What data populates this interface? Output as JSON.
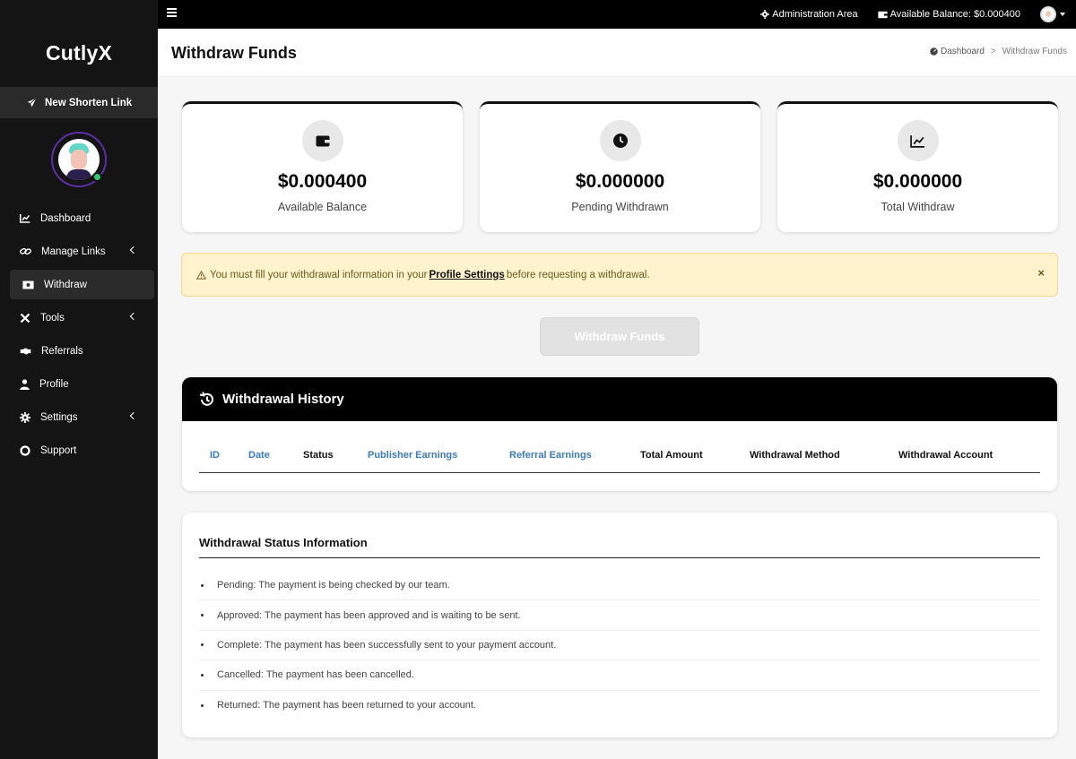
{
  "app": {
    "brand": "CutlyX"
  },
  "topbar": {
    "admin_label": "Administration Area",
    "balance_label": "Available Balance: $0.000400"
  },
  "sidebar": {
    "new_link_label": "New Shorten Link",
    "items": [
      {
        "label": "Dashboard",
        "icon": "chart-line-icon"
      },
      {
        "label": "Manage Links",
        "icon": "link-icon"
      },
      {
        "label": "Withdraw",
        "icon": "money-bill-icon"
      },
      {
        "label": "Tools",
        "icon": "tools-icon"
      },
      {
        "label": "Referrals",
        "icon": "handshake-icon"
      },
      {
        "label": "Profile",
        "icon": "user-icon"
      },
      {
        "label": "Settings",
        "icon": "gear-icon"
      },
      {
        "label": "Support",
        "icon": "lifebuoy-icon"
      }
    ]
  },
  "header": {
    "title": "Withdraw Funds",
    "breadcrumb": {
      "home": "Dashboard",
      "separator": ">",
      "current": "Withdraw Funds"
    }
  },
  "stats": [
    {
      "value": "$0.000400",
      "label": "Available Balance",
      "icon": "wallet-icon"
    },
    {
      "value": "$0.000000",
      "label": "Pending Withdrawn",
      "icon": "clock-icon"
    },
    {
      "value": "$0.000000",
      "label": "Total Withdraw",
      "icon": "chart-line-icon"
    }
  ],
  "alert": {
    "prefix": "You must fill your withdrawal information in your",
    "link": "Profile Settings",
    "suffix": "before requesting a withdrawal.",
    "close": "×"
  },
  "withdraw_button": "Withdraw Funds",
  "history": {
    "title": "Withdrawal History",
    "columns": [
      "ID",
      "Date",
      "Status",
      "Publisher Earnings",
      "Referral Earnings",
      "Total Amount",
      "Withdrawal Method",
      "Withdrawal Account"
    ]
  },
  "status_info": {
    "title": "Withdrawal Status Information",
    "items": [
      "Pending: The payment is being checked by our team.",
      "Approved: The payment has been approved and is waiting to be sent.",
      "Complete: The payment has been successfully sent to your payment account.",
      "Cancelled: The payment has been cancelled.",
      "Returned: The payment has been returned to your account."
    ]
  },
  "colors": {
    "sidebar_bg": "#141414",
    "topbar_bg": "#000000",
    "alert_bg": "#fff3cd",
    "link_blue": "#3d7ab8",
    "online_green": "#2ecc71",
    "avatar_ring": "#5b2fa8"
  }
}
